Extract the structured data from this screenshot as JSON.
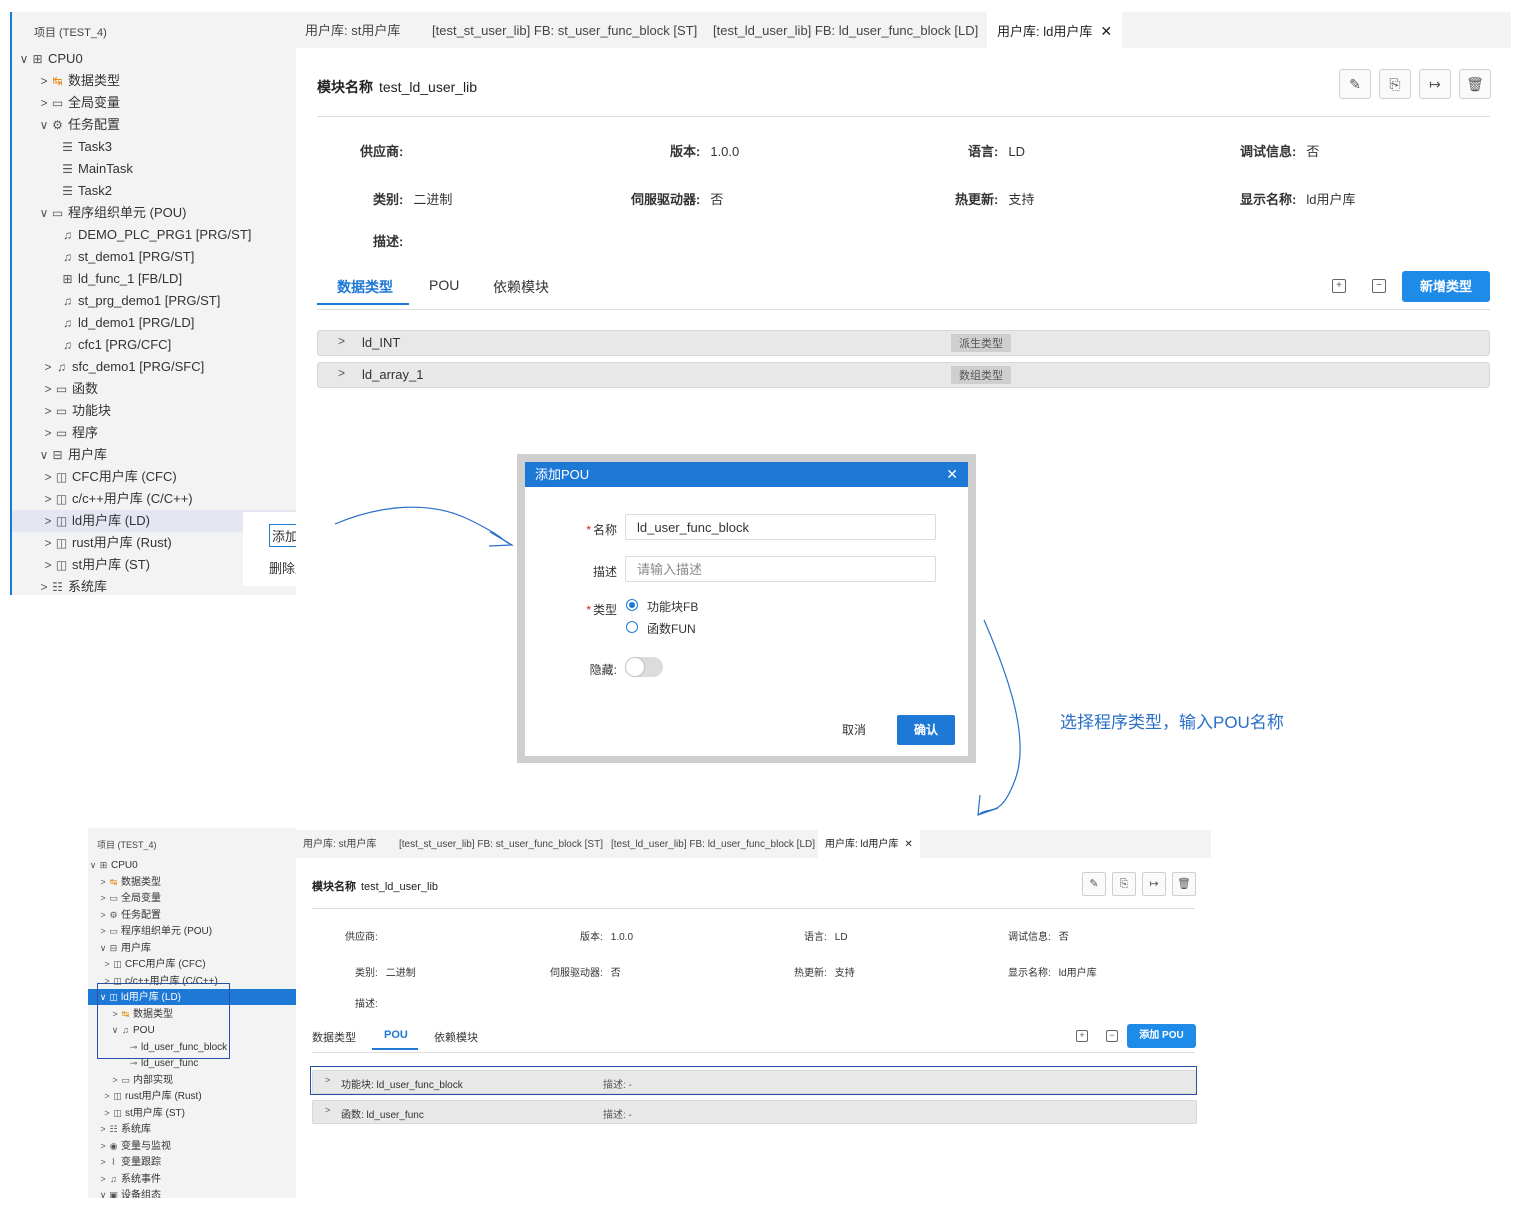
{
  "top": {
    "sidebar": {
      "title": "项目 (TEST_4)",
      "items": [
        {
          "label": "CPU0",
          "icon": "cpu-icon",
          "chevron": "∨"
        },
        {
          "label": "数据类型",
          "icon": "datatype-icon",
          "chevron": ">"
        },
        {
          "label": "全局变量",
          "icon": "folder-icon",
          "chevron": ">"
        },
        {
          "label": "任务配置",
          "icon": "gear-icon",
          "chevron": "∨"
        },
        {
          "label": "Task3",
          "icon": "task-list-icon",
          "chevron": ""
        },
        {
          "label": "MainTask",
          "icon": "task-list-icon",
          "chevron": ""
        },
        {
          "label": "Task2",
          "icon": "task-list-icon",
          "chevron": ""
        },
        {
          "label": "程序组织单元 (POU)",
          "icon": "folder-icon",
          "chevron": "∨"
        },
        {
          "label": "DEMO_PLC_PRG1 [PRG/ST]",
          "icon": "program-icon",
          "chevron": ""
        },
        {
          "label": "st_demo1 [PRG/ST]",
          "icon": "program-icon",
          "chevron": ""
        },
        {
          "label": "ld_func_1 [FB/LD]",
          "icon": "function-block-icon",
          "chevron": ""
        },
        {
          "label": "st_prg_demo1 [PRG/ST]",
          "icon": "program-icon",
          "chevron": ""
        },
        {
          "label": "ld_demo1 [PRG/LD]",
          "icon": "program-icon",
          "chevron": ""
        },
        {
          "label": "cfc1 [PRG/CFC]",
          "icon": "program-icon",
          "chevron": ""
        },
        {
          "label": "sfc_demo1 [PRG/SFC]",
          "icon": "program-icon",
          "chevron": ">"
        },
        {
          "label": "函数",
          "icon": "folder-icon",
          "chevron": ">"
        },
        {
          "label": "功能块",
          "icon": "folder-icon",
          "chevron": ">"
        },
        {
          "label": "程序",
          "icon": "folder-icon",
          "chevron": ">"
        },
        {
          "label": "用户库",
          "icon": "library-icon",
          "chevron": "∨"
        },
        {
          "label": "CFC用户库 (CFC)",
          "icon": "book-icon",
          "chevron": ">"
        },
        {
          "label": "c/c++用户库 (C/C++)",
          "icon": "book-icon",
          "chevron": ">"
        },
        {
          "label": "ld用户库 (LD)",
          "icon": "book-icon",
          "chevron": ">"
        },
        {
          "label": "rust用户库 (Rust)",
          "icon": "book-icon",
          "chevron": ">"
        },
        {
          "label": "st用户库 (ST)",
          "icon": "book-icon",
          "chevron": ">"
        },
        {
          "label": "系统库",
          "icon": "archive-icon",
          "chevron": ">"
        }
      ]
    },
    "context_menu": {
      "add": "添加POU",
      "delete": "删除用户库"
    },
    "tabs": [
      {
        "label": "用户库: st用户库"
      },
      {
        "label": "[test_st_user_lib] FB: st_user_func_block [ST]"
      },
      {
        "label": "[test_ld_user_lib] FB: ld_user_func_block [LD]"
      },
      {
        "label": "用户库: ld用户库",
        "close": "✕"
      }
    ],
    "module": {
      "label": "模块名称",
      "name": "test_ld_user_lib"
    },
    "info": {
      "vendor_k": "供应商:",
      "vendor_v": "",
      "version_k": "版本:",
      "version_v": "1.0.0",
      "language_k": "语言:",
      "language_v": "LD",
      "debug_k": "调试信息:",
      "debug_v": "否",
      "category_k": "类别:",
      "category_v": "二进制",
      "servo_k": "伺服驱动器:",
      "servo_v": "否",
      "hot_k": "热更新:",
      "hot_v": "支持",
      "display_k": "显示名称:",
      "display_v": "ld用户库",
      "desc_k": "描述:"
    },
    "subtabs": {
      "datatype": "数据类型",
      "pou": "POU",
      "deps": "依赖模块"
    },
    "add_type_btn": "新增类型",
    "rows": [
      {
        "name": "ld_INT",
        "tag": "派生类型"
      },
      {
        "name": "ld_array_1",
        "tag": "数组类型"
      }
    ]
  },
  "dialog": {
    "title": "添加POU",
    "close": "✕",
    "name_label": "名称",
    "name_value": "ld_user_func_block",
    "desc_label": "描述",
    "desc_placeholder": "请输入描述",
    "type_label": "类型",
    "type_options": [
      "功能块FB",
      "函数FUN"
    ],
    "hidden_label": "隐藏:",
    "cancel": "取消",
    "ok": "确认"
  },
  "annotation": "选择程序类型，输入POU名称",
  "bottom": {
    "sidebar": {
      "title": "项目 (TEST_4)",
      "items": [
        {
          "label": "CPU0",
          "icon": "cpu-icon",
          "chevron": "∨"
        },
        {
          "label": "数据类型",
          "icon": "datatype-icon",
          "chevron": ">"
        },
        {
          "label": "全局变量",
          "icon": "folder-icon",
          "chevron": ">"
        },
        {
          "label": "任务配置",
          "icon": "gear-icon",
          "chevron": ">"
        },
        {
          "label": "程序组织单元 (POU)",
          "icon": "folder-icon",
          "chevron": ">"
        },
        {
          "label": "用户库",
          "icon": "library-icon",
          "chevron": "∨"
        },
        {
          "label": "CFC用户库 (CFC)",
          "icon": "book-icon",
          "chevron": ">"
        },
        {
          "label": "c/c++用户库 (C/C++)",
          "icon": "book-icon",
          "chevron": ">"
        },
        {
          "label": "ld用户库 (LD)",
          "icon": "book-icon",
          "chevron": "∨"
        },
        {
          "label": "数据类型",
          "icon": "datatype-icon",
          "chevron": ">"
        },
        {
          "label": "POU",
          "icon": "program-icon",
          "chevron": "∨"
        },
        {
          "label": "ld_user_func_block",
          "icon": "link-icon",
          "chevron": ""
        },
        {
          "label": "ld_user_func",
          "icon": "link-icon",
          "chevron": ""
        },
        {
          "label": "内部实现",
          "icon": "folder-icon",
          "chevron": ">"
        },
        {
          "label": "rust用户库 (Rust)",
          "icon": "book-icon",
          "chevron": ">"
        },
        {
          "label": "st用户库 (ST)",
          "icon": "book-icon",
          "chevron": ">"
        },
        {
          "label": "系统库",
          "icon": "archive-icon",
          "chevron": ">"
        },
        {
          "label": "变量与监视",
          "icon": "eye-icon",
          "chevron": ">"
        },
        {
          "label": "变量跟踪",
          "icon": "chart-icon",
          "chevron": ">"
        },
        {
          "label": "系统事件",
          "icon": "bell-icon",
          "chevron": ">"
        },
        {
          "label": "设备组态",
          "icon": "device-icon",
          "chevron": "∨"
        }
      ]
    },
    "tabs": [
      {
        "label": "用户库: st用户库"
      },
      {
        "label": "[test_st_user_lib] FB: st_user_func_block [ST]"
      },
      {
        "label": "[test_ld_user_lib] FB: ld_user_func_block [LD]"
      },
      {
        "label": "用户库: ld用户库",
        "close": "✕"
      }
    ],
    "add_pou_btn": "添加 POU",
    "rows": [
      {
        "name": "功能块: ld_user_func_block",
        "desc": "描述: -"
      },
      {
        "name": "函数: ld_user_func",
        "desc": "描述: -"
      }
    ]
  },
  "colors": {
    "accent": "#1e78d6",
    "button": "#1e8be8",
    "sidebar_bg": "#f3f3f3",
    "annotation": "#2a6fc8"
  }
}
